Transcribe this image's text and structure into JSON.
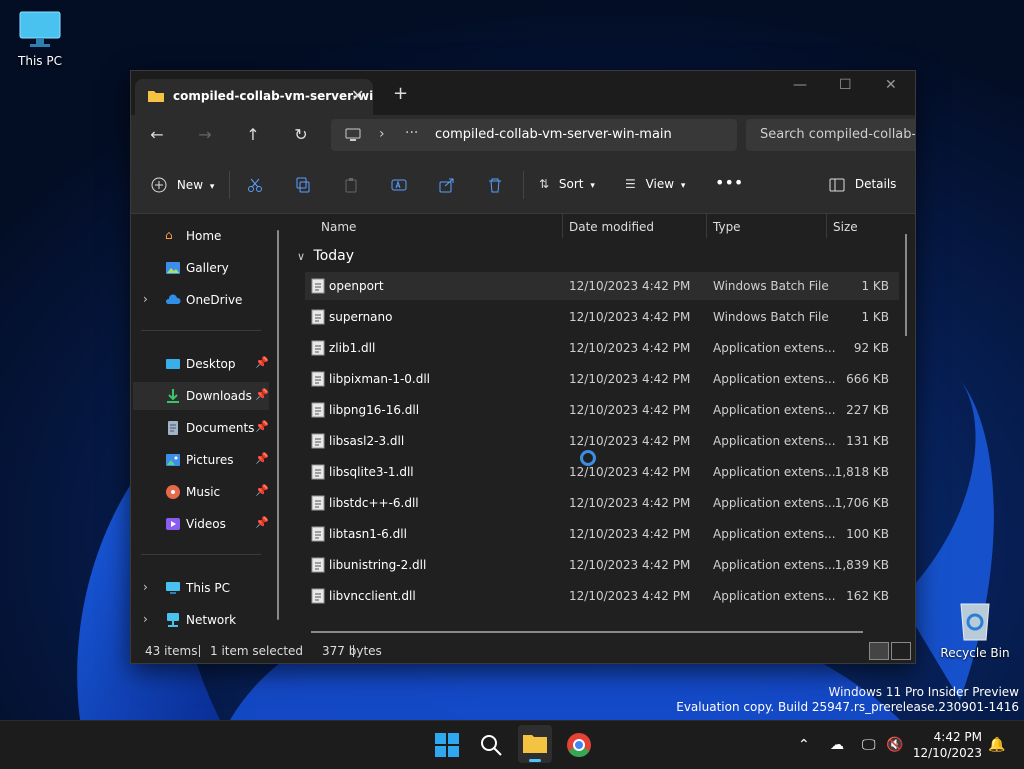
{
  "desktop": {
    "this_pc": "This PC",
    "recycle_bin": "Recycle Bin",
    "watermark_line1": "Windows 11 Pro Insider Preview",
    "watermark_line2": "Evaluation copy. Build 25947.rs_prerelease.230901-1416"
  },
  "explorer": {
    "tab_title": "compiled-collab-vm-server-wi",
    "path": "compiled-collab-vm-server-win-main",
    "search_placeholder": "Search compiled-collab-v",
    "commands": {
      "new": "New",
      "sort": "Sort",
      "view": "View",
      "details": "Details"
    },
    "nav": {
      "home": "Home",
      "gallery": "Gallery",
      "onedrive": "OneDrive",
      "desktop": "Desktop",
      "downloads": "Downloads",
      "documents": "Documents",
      "pictures": "Pictures",
      "music": "Music",
      "videos": "Videos",
      "this_pc": "This PC",
      "network": "Network"
    },
    "columns": {
      "name": "Name",
      "date": "Date modified",
      "type": "Type",
      "size": "Size"
    },
    "group": "Today",
    "files": [
      {
        "name": "openport",
        "date": "12/10/2023 4:42 PM",
        "type": "Windows Batch File",
        "size": "1 KB"
      },
      {
        "name": "supernano",
        "date": "12/10/2023 4:42 PM",
        "type": "Windows Batch File",
        "size": "1 KB"
      },
      {
        "name": "zlib1.dll",
        "date": "12/10/2023 4:42 PM",
        "type": "Application extens...",
        "size": "92 KB"
      },
      {
        "name": "libpixman-1-0.dll",
        "date": "12/10/2023 4:42 PM",
        "type": "Application extens...",
        "size": "666 KB"
      },
      {
        "name": "libpng16-16.dll",
        "date": "12/10/2023 4:42 PM",
        "type": "Application extens...",
        "size": "227 KB"
      },
      {
        "name": "libsasl2-3.dll",
        "date": "12/10/2023 4:42 PM",
        "type": "Application extens...",
        "size": "131 KB"
      },
      {
        "name": "libsqlite3-1.dll",
        "date": "12/10/2023 4:42 PM",
        "type": "Application extens...",
        "size": "1,818 KB"
      },
      {
        "name": "libstdc++-6.dll",
        "date": "12/10/2023 4:42 PM",
        "type": "Application extens...",
        "size": "1,706 KB"
      },
      {
        "name": "libtasn1-6.dll",
        "date": "12/10/2023 4:42 PM",
        "type": "Application extens...",
        "size": "100 KB"
      },
      {
        "name": "libunistring-2.dll",
        "date": "12/10/2023 4:42 PM",
        "type": "Application extens...",
        "size": "1,839 KB"
      },
      {
        "name": "libvncclient.dll",
        "date": "12/10/2023 4:42 PM",
        "type": "Application extens...",
        "size": "162 KB"
      }
    ],
    "status": {
      "count": "43 items",
      "selected": "1 item selected",
      "bytes": "377 bytes"
    }
  },
  "taskbar": {
    "time": "4:42 PM",
    "date": "12/10/2023"
  },
  "colors": {
    "accent": "#3a8ee6",
    "window_bg": "#202020",
    "toolbar_bg": "#2c2c2c"
  }
}
